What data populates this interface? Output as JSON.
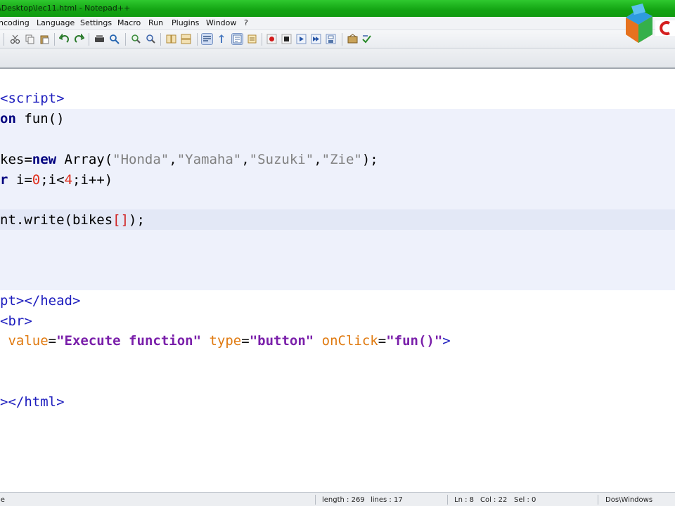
{
  "window": {
    "title": "\\Desktop\\lec11.html - Notepad++"
  },
  "menu": {
    "items": [
      "ncoding",
      "Language",
      "Settings",
      "Macro",
      "Run",
      "Plugins",
      "Window",
      "?"
    ]
  },
  "toolbar": {
    "icons": [
      "cut-icon",
      "copy-icon",
      "paste-icon",
      "undo-icon",
      "redo-icon",
      "find-icon",
      "replace-icon",
      "zoom-in-icon",
      "zoom-out-icon",
      "sync-v-icon",
      "sync-h-icon",
      "word-wrap-icon",
      "indent-guide-icon",
      "doc-map-icon",
      "record-macro-icon",
      "stop-record-icon",
      "play-macro-icon",
      "run-macro-multiple-icon",
      "save-macro-icon",
      "function-list-icon",
      "spell-check-icon"
    ]
  },
  "editor": {
    "lines": {
      "l1": "<script>",
      "l2_kw": "on",
      "l2_rest": " fun()",
      "l4_a": "kes=",
      "l4_new": "new",
      "l4_b": " Array(",
      "l4_s1": "\"Honda\"",
      "l4_s2": "\"Yamaha\"",
      "l4_s3": "\"Suzuki\"",
      "l4_s4": "\"Zie\"",
      "l4_c": ");",
      "l5_kw": "r",
      "l5_a": " i=",
      "l5_n1": "0",
      "l5_b": ";i<",
      "l5_n2": "4",
      "l5_c": ";i++)",
      "l7_a": "nt.write(bikes",
      "l7_br": "[]",
      "l7_c": ");",
      "l11": "pt></head>",
      "l12": "<br>",
      "l13_attr1": "value",
      "l13_val1": "\"Execute function\"",
      "l13_attr2": "type",
      "l13_val2": "\"button\"",
      "l13_attr3": "onClick",
      "l13_val3": "\"fun()\"",
      "l13_end": ">",
      "l16": "></html>"
    }
  },
  "status": {
    "type": "le",
    "length": "length : 269",
    "lines": "lines : 17",
    "ln": "Ln : 8",
    "col": "Col : 22",
    "sel": "Sel : 0",
    "eol": "Dos\\Windows"
  }
}
